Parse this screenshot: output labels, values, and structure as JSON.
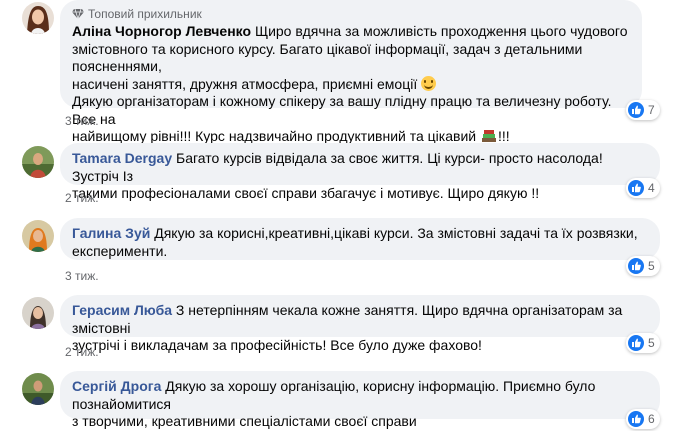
{
  "comments": [
    {
      "badge": "Топовий прихильник",
      "author": "Аліна Чорногор Левченко",
      "text_lines": [
        "Щиро вдячна за можливість проходження цього чудового",
        "змістовного та корисного курсу. Багато цікавої інформації, задач з детальними поясненнями,",
        "насичені заняття, дружня атмосфера, приємні емоції",
        "Дякую організаторам і кожному спікеру за вашу плідну працю та величезну роботу. Все на",
        "найвищому рівні!!! Курс надзвичайно продуктивний та цікавий",
        "!!!"
      ],
      "time": "3 тиж.",
      "likes": "7",
      "icons": [
        "diamond-icon",
        "smiling-face-icon",
        "books-icon",
        "like-icon"
      ]
    },
    {
      "author": "Tamara Dergay",
      "text_lines": [
        "Багато курсів відвідала за своє життя. Ці курси- просто насолода! Зустріч Із",
        "такими професіоналами своєї справи збагачує і мотивує. Щиро дякую !!"
      ],
      "time": "2 тиж.",
      "likes": "4"
    },
    {
      "author": "Галина Зуй",
      "text_lines": [
        "Дякую за корисні,креативні,цікаві курси. За змістовні задачі та їх розвязки,",
        "експерименти."
      ],
      "time": "3 тиж.",
      "likes": "5"
    },
    {
      "author": "Герасим Люба",
      "text_lines": [
        "З нетерпінням чекала кожне заняття. Щиро вдячна організаторам за змістовні",
        "зустрічі і викладачам за професійність! Все було дуже фахово!"
      ],
      "time": "2 тиж.",
      "likes": "5"
    },
    {
      "author": "Сергій Дрога",
      "text_lines": [
        "Дякую за хорошу організацію, корисну інформацію. Приємно було познайомитися",
        "з творчими, креативними спеціалістами своєї справи"
      ],
      "time": "",
      "likes": "6"
    }
  ],
  "colors": {
    "bubble": "#f0f2f5",
    "author": "#385898",
    "meta": "#65676b",
    "like": "#1877f2"
  }
}
